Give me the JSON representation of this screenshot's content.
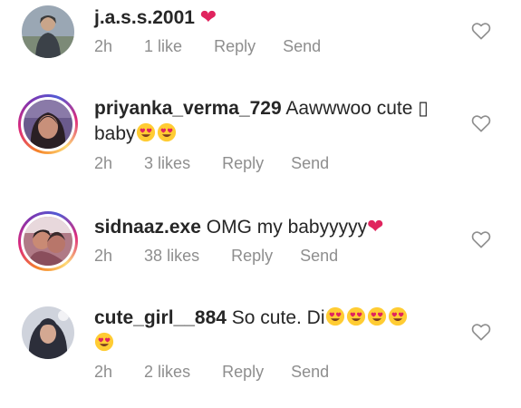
{
  "comments": [
    {
      "username": "j.a.s.s.2001",
      "text": "",
      "time": "2h",
      "likes": "1 like",
      "reply": "Reply",
      "send": "Send",
      "avatar": "profile-photo-man-in-hoodie",
      "story_ring": false
    },
    {
      "username": "priyanka_verma_729",
      "text": "Aawwwoo cute ▯",
      "text_line2": "baby",
      "time": "2h",
      "likes": "3 likes",
      "reply": "Reply",
      "send": "Send",
      "avatar": "profile-photo-woman",
      "story_ring": true
    },
    {
      "username": "sidnaaz.exe",
      "text": "OMG my babyyyyy",
      "time": "2h",
      "likes": "38 likes",
      "reply": "Reply",
      "send": "Send",
      "avatar": "profile-photo-couple",
      "story_ring": true
    },
    {
      "username": "cute_girl__884",
      "text": "So cute. Di",
      "time": "2h",
      "likes": "2 likes",
      "reply": "Reply",
      "send": "Send",
      "avatar": "profile-photo-girl-hijab",
      "story_ring": false
    }
  ],
  "icons": {
    "heart_outline": "heart-outline-icon",
    "red_heart_emoji": "red-heart-emoji",
    "heart_eyes_emoji": "heart-eyes-emoji"
  },
  "colors": {
    "text": "#262626",
    "meta": "#8e8e8e",
    "heart": "#e0245e",
    "emoji_face": "#ffcc33"
  }
}
